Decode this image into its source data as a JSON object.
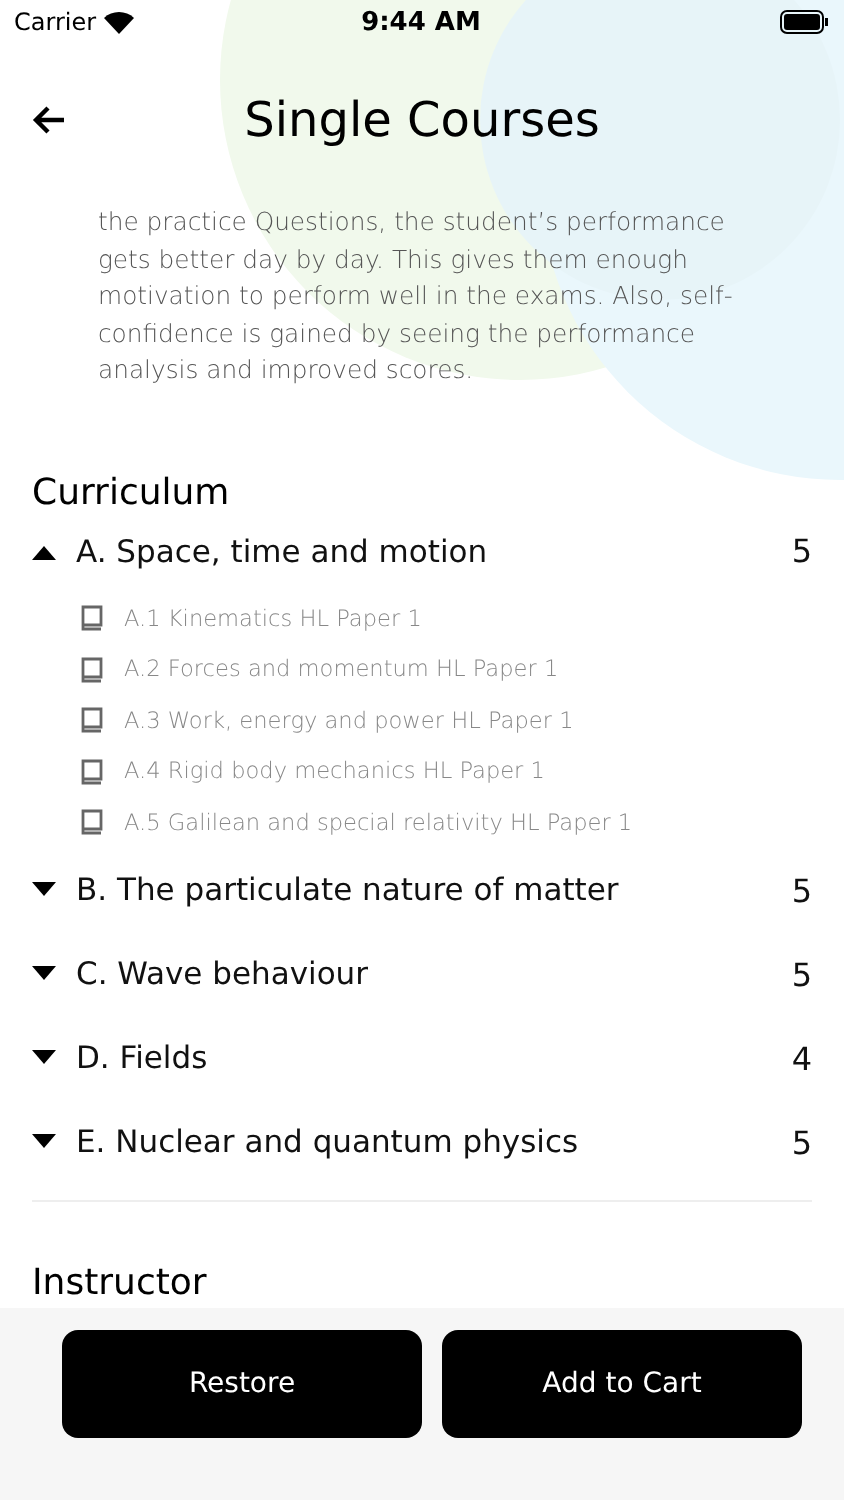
{
  "status_bar": {
    "carrier": "Carrier",
    "time": "9:44 AM"
  },
  "header": {
    "title": "Single Courses"
  },
  "description": "the practice Questions, the student’s performance gets better day by day. This gives them enough motivation to perform well in the exams. Also, self-confidence is gained by seeing the performance analysis and improved scores.",
  "curriculum": {
    "heading": "Curriculum",
    "sections": [
      {
        "title": "A. Space, time and motion",
        "count": "5",
        "expanded": true,
        "lessons": [
          "A.1 Kinematics HL Paper 1",
          "A.2 Forces and momentum HL Paper 1",
          "A.3 Work, energy and power HL Paper 1",
          "A.4 Rigid body mechanics HL Paper 1",
          "A.5 Galilean and special relativity HL Paper 1"
        ]
      },
      {
        "title": "B. The particulate nature of matter",
        "count": "5",
        "expanded": false
      },
      {
        "title": "C. Wave behaviour",
        "count": "5",
        "expanded": false
      },
      {
        "title": "D. Fields",
        "count": "4",
        "expanded": false
      },
      {
        "title": "E. Nuclear and quantum physics",
        "count": "5",
        "expanded": false
      }
    ]
  },
  "instructor": {
    "heading": "Instructor"
  },
  "buttons": [
    "Restore",
    "Add to Cart"
  ]
}
